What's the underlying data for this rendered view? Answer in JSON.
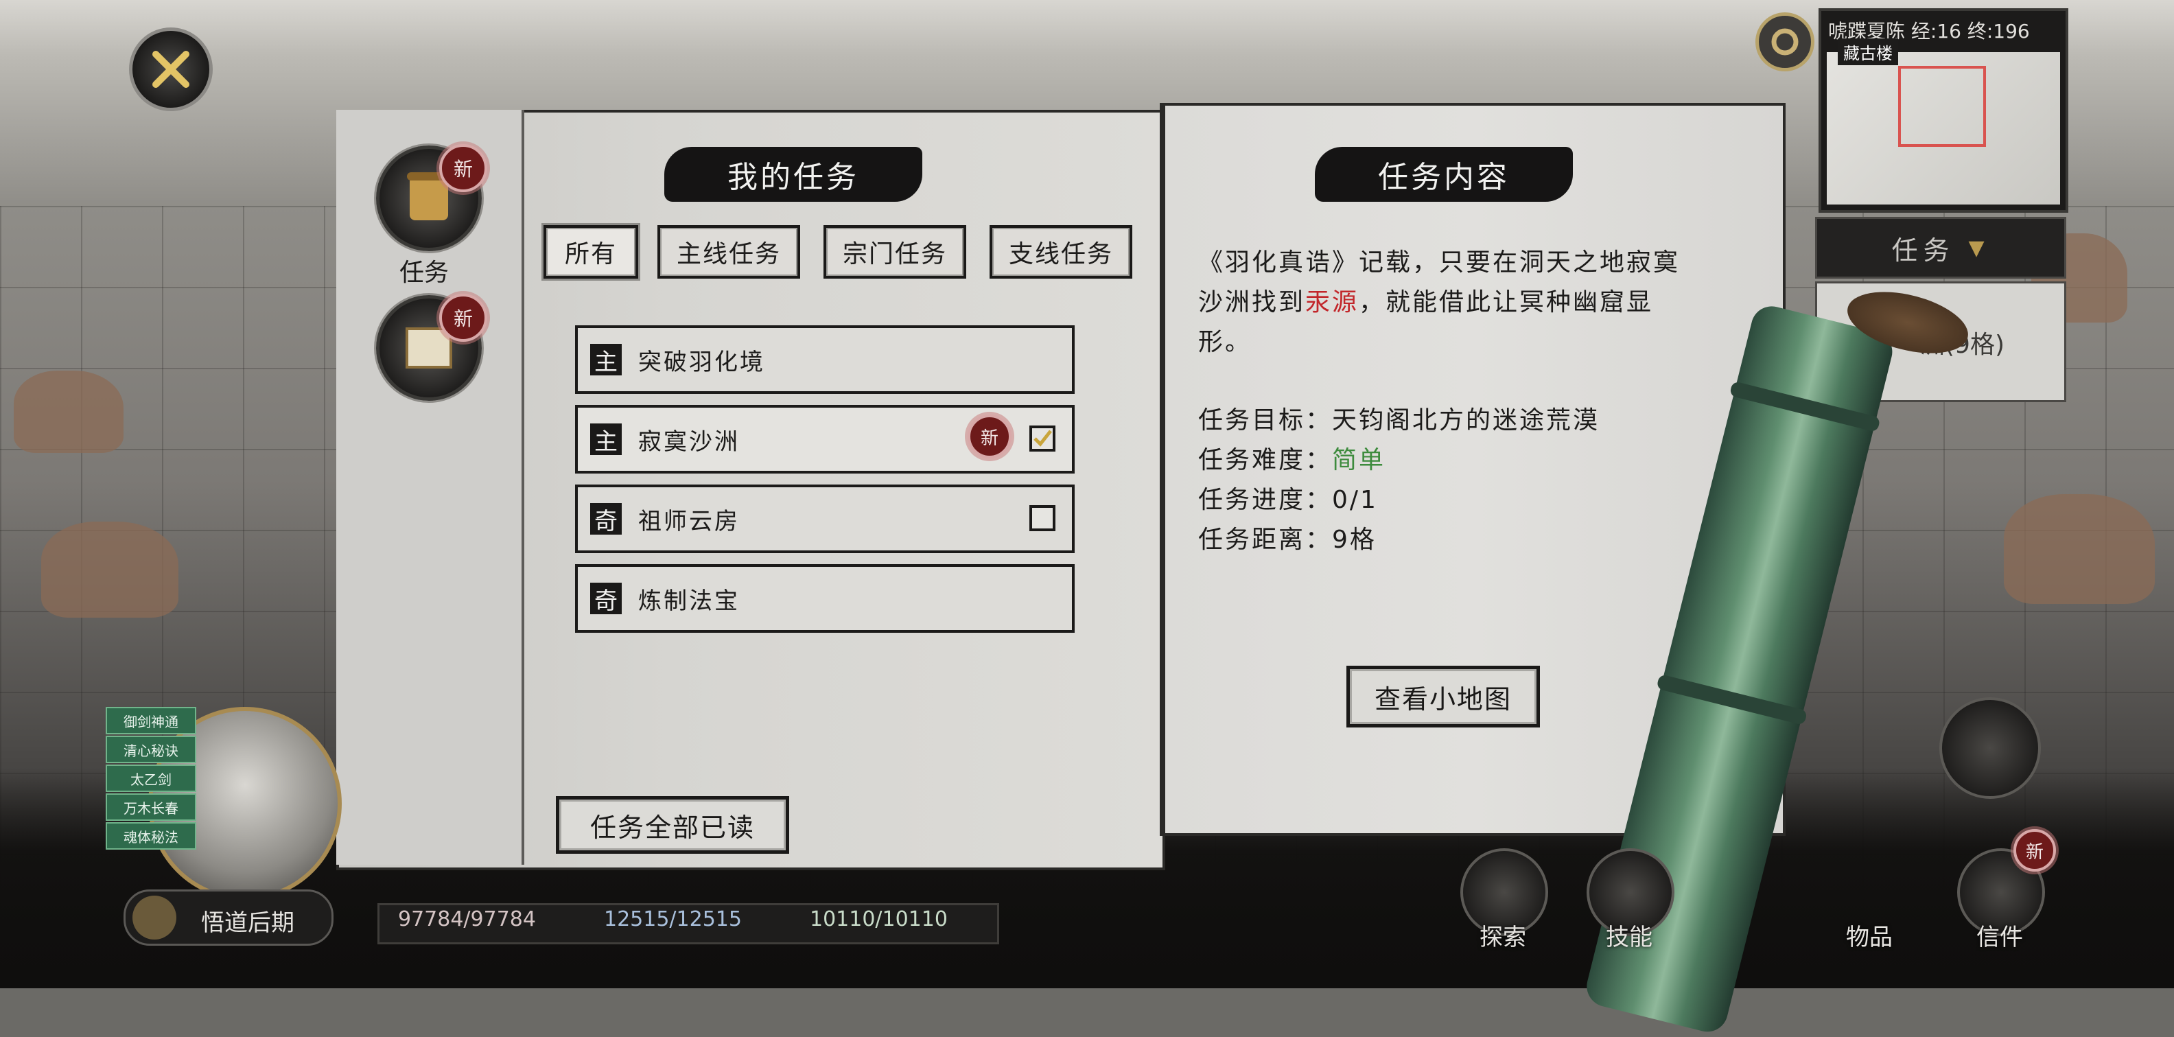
{
  "window": {
    "title": "我的任务"
  },
  "top_right": {
    "minimap_header": "唬蹀夏陈 经:16 终:196",
    "minimap_label": "藏古楼",
    "task_panel_label": "任务",
    "task_panel_sub": "洲(9格)"
  },
  "left_menu": [
    {
      "label": "任务",
      "icon": "scroll-icon",
      "badge": "新"
    },
    {
      "label": "",
      "icon": "letter-icon",
      "badge": "新"
    }
  ],
  "list_panel": {
    "title": "我的任务",
    "tabs": [
      {
        "label": "所有",
        "active": true
      },
      {
        "label": "主线任务",
        "active": false
      },
      {
        "label": "宗门任务",
        "active": false
      },
      {
        "label": "支线任务",
        "active": false
      }
    ],
    "quests": [
      {
        "type": "主",
        "name": "突破羽化境",
        "is_new": false,
        "checkbox": null
      },
      {
        "type": "主",
        "name": "寂寞沙洲",
        "is_new": true,
        "new_label": "新",
        "checkbox": "checked"
      },
      {
        "type": "奇",
        "name": "祖师云房",
        "is_new": false,
        "checkbox": "unchecked"
      },
      {
        "type": "奇",
        "name": "炼制法宝",
        "is_new": false,
        "checkbox": null
      }
    ],
    "mark_all_read_label": "任务全部已读"
  },
  "detail_panel": {
    "title": "任务内容",
    "desc_line1": "《羽化真诰》记载，只要在洞天之地寂寞",
    "desc_line2_prefix": "沙洲找到",
    "desc_highlight": "汞源",
    "desc_line2_suffix": "，就能借此让冥种幽窟显",
    "desc_line3": "形。",
    "goal_label": "任务目标：",
    "goal_value": "天钧阁北方的迷途荒漠",
    "difficulty_label": "任务难度：",
    "difficulty_value": "简单",
    "progress_label": "任务进度：",
    "progress_value": "0/1",
    "distance_label": "任务距离：",
    "distance_value": "9格",
    "view_map_label": "查看小地图",
    "colors": {
      "highlight": "#c2262a",
      "difficulty": "#3d8b3d"
    }
  },
  "hud": {
    "realm_label": "悟道后期",
    "hp": "97784/97784",
    "mp": "12515/12515",
    "stamina": "10110/10110",
    "skill_tags": [
      "御剑神通",
      "清心秘诀",
      "太乙剑",
      "万木长春",
      "魂体秘法"
    ],
    "bottom_menu": [
      {
        "label": "探索",
        "icon": "explore-icon"
      },
      {
        "label": "技能",
        "icon": "yin-yang-icon"
      },
      {
        "label": "物品",
        "icon": "bag-icon"
      },
      {
        "label": "信件",
        "icon": "letter-icon",
        "badge": "新"
      }
    ]
  }
}
